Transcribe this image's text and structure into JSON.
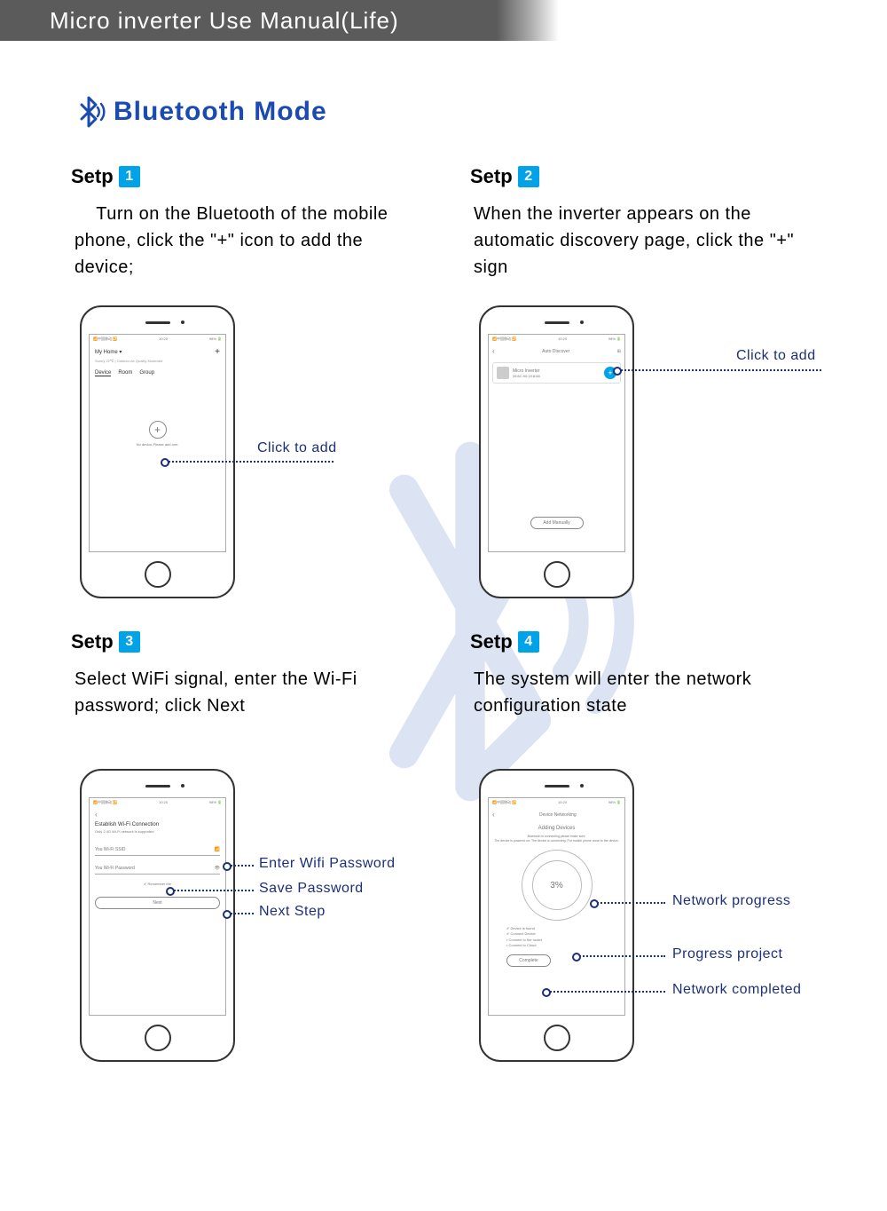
{
  "header": {
    "title": "Micro inverter Use Manual(Life)"
  },
  "section": {
    "title": "Bluetooth Mode"
  },
  "steps": [
    {
      "label": "Setp",
      "num": "1",
      "desc": "    Turn on the Bluetooth of the mobile phone, click the \"+\" icon to add the device;",
      "callouts": [
        {
          "text": "Click to add"
        }
      ],
      "screen": {
        "status": {
          "left": "📶中国移动 🔁",
          "center": "10:20",
          "right": "98% 🔋"
        },
        "title": "My Home ▾",
        "plus": "+",
        "sub": "Sunny 22℃ | Outdoor Air Quality Moderate",
        "tabs": [
          "Device",
          "Room",
          "Group"
        ],
        "nodev": "No device,Please add one."
      }
    },
    {
      "label": "Setp",
      "num": "2",
      "desc": "When the inverter appears on the automatic discovery page, click the \"+\" sign",
      "callouts": [
        {
          "text": "Click to add"
        }
      ],
      "screen": {
        "status": {
          "left": "📶中国移动 🔁",
          "center": "10:20",
          "right": "98% 🔋"
        },
        "back": "‹",
        "title": "Auto Discover",
        "scan": "⊞",
        "dev_name": "Micro Inverter",
        "dev_mac": "28:6C:90:19:8:88",
        "manual": "Add Manually"
      }
    },
    {
      "label": "Setp",
      "num": "3",
      "desc": "Select WiFi signal, enter the Wi-Fi password; click Next",
      "callouts": [
        {
          "text": "Enter Wifi Password"
        },
        {
          "text": "Save Password"
        },
        {
          "text": "Next Step"
        }
      ],
      "screen": {
        "status": {
          "left": "📶中国移动 🔁",
          "center": "10:20",
          "right": "98% 🔋"
        },
        "back": "‹",
        "title": "Establish Wi-Fi Connection",
        "sub": "Only 2.4G Wi-Fi network is supported",
        "ssid": "You Wi-Fi SSID",
        "ssid_icon": "📶",
        "pwd": "You Wi-Fi Password",
        "pwd_icon": "👁",
        "remember": "✔ Remember Me",
        "next": "Next"
      }
    },
    {
      "label": "Setp",
      "num": "4",
      "desc": "The system will enter the network configuration state",
      "callouts": [
        {
          "text": "Network progress"
        },
        {
          "text": "Progress project"
        },
        {
          "text": "Network completed"
        }
      ],
      "screen": {
        "status": {
          "left": "📶中国移动 🔁",
          "center": "10:20",
          "right": "98% 🔋"
        },
        "back": "‹",
        "title": "Device Networking",
        "adding": "Adding Devices",
        "sub": "Bluetooth is connecting,please make sure:\nThe device is powered on; The device is connecting; Put mobile phone close to the device;",
        "progress": "3%",
        "items": [
          "✔  Device is found",
          "✔  Connect Device",
          "•  Connect to the router",
          "•  Connect to Cloud"
        ],
        "complete": "Complete"
      }
    }
  ]
}
